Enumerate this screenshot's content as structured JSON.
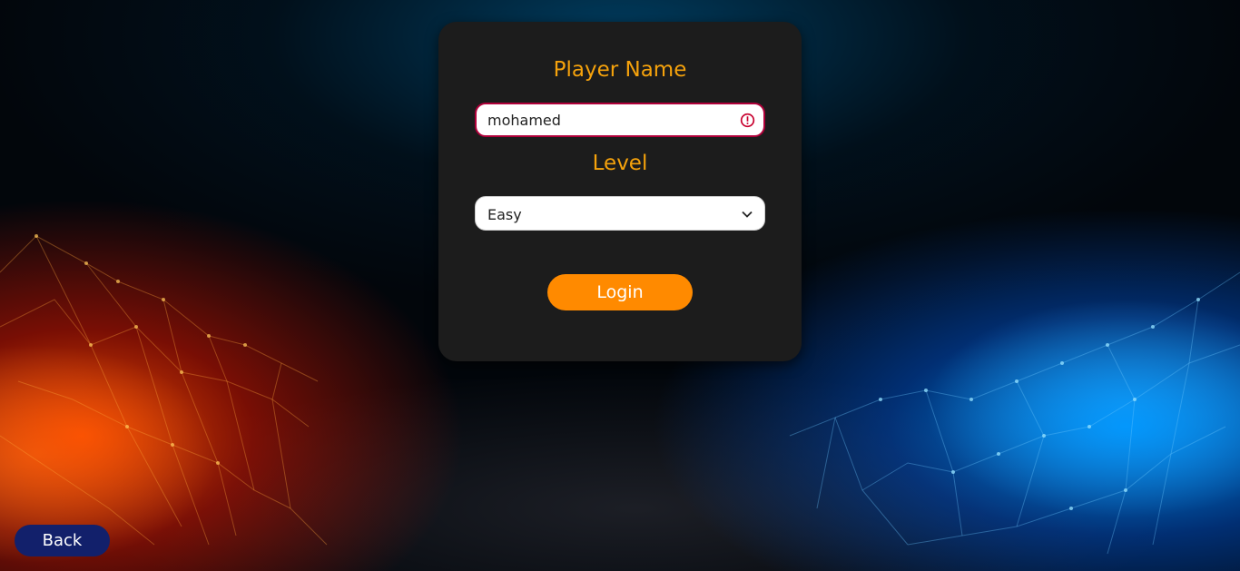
{
  "form": {
    "player_name_heading": "Player Name",
    "player_name_value": "mohamed",
    "player_name_state": "invalid",
    "level_heading": "Level",
    "level_selected": "Easy",
    "login_label": "Login"
  },
  "nav": {
    "back_label": "Back"
  },
  "icons": {
    "name_status": "alert-circle-icon",
    "level_dropdown": "chevron-down-icon"
  },
  "colors": {
    "heading": "#f5a20c",
    "login_button": "#ff8a00",
    "back_button": "#12206b",
    "card_background": "#1c1c1c",
    "invalid_border": "#b0003a"
  }
}
